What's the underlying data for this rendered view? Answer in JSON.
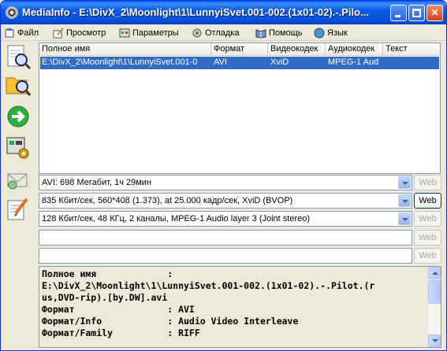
{
  "window": {
    "title": "MediaInfo - E:\\DivX_2\\Moonlight\\1\\LunnyiSvet.001-002.(1x01-02).-.Pilo..."
  },
  "menu": [
    {
      "label": "Файл",
      "icon": "file-icon"
    },
    {
      "label": "Просмотр",
      "icon": "view-icon"
    },
    {
      "label": "Параметры",
      "icon": "options-icon"
    },
    {
      "label": "Отладка",
      "icon": "debug-icon"
    },
    {
      "label": "Помощь",
      "icon": "help-icon"
    },
    {
      "label": "Язык",
      "icon": "language-icon"
    }
  ],
  "toolbar": [
    {
      "name": "open-file-icon"
    },
    {
      "name": "open-folder-icon"
    },
    {
      "name": "next-arrow-icon"
    },
    {
      "name": "settings-icon"
    },
    {
      "name": "send-mail-icon"
    },
    {
      "name": "notes-icon"
    }
  ],
  "list": {
    "columns": [
      "Полное имя",
      "Формат",
      "Видеокодек",
      "Аудиокодек",
      "Текст"
    ],
    "row": [
      "E:\\DivX_2\\Moonlight\\1\\LunnyiSvet.001-0",
      "AVI",
      "XviD",
      "MPEG-1 Aud",
      ""
    ]
  },
  "combos": [
    {
      "value": "AVI: 698 Мегабит, 1ч 29мин",
      "web": "Web",
      "web_enabled": false
    },
    {
      "value": "835 Кбит/сек, 560*408 (1.373),  at 25.000 кадр/сек, XviD (BVOP)",
      "web": "Web",
      "web_enabled": true
    },
    {
      "value": "128 Кбит/сек, 48 КГц, 2 каналы, MPEG-1 Audio layer 3 (Joint stereo)",
      "web": "Web",
      "web_enabled": false
    },
    {
      "value": "",
      "web": "Web",
      "web_enabled": false
    },
    {
      "value": "",
      "web": "Web",
      "web_enabled": false
    }
  ],
  "info": {
    "lines": [
      "Полное имя             :",
      "E:\\DivX_2\\Moonlight\\1\\LunnyiSvet.001-002.(1x01-02).-.Pilot.(r",
      "us,DVD-rip).[by.DW].avi",
      "Формат                 : AVI",
      "Формат/Info            : Audio Video Interleave",
      "Формат/Family          : RIFF"
    ]
  }
}
